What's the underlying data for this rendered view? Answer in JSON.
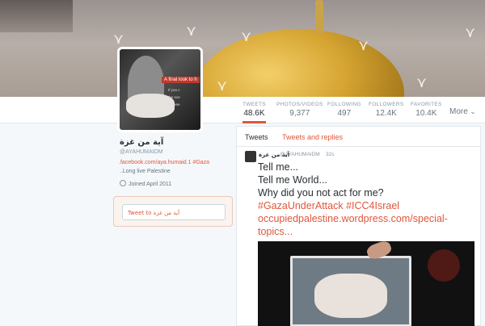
{
  "banner": {
    "birds": [
      "bird",
      "bird",
      "bird",
      "bird",
      "bird",
      "bird",
      "bird",
      "bird"
    ]
  },
  "nav": {
    "stats": [
      {
        "label": "TWEETS",
        "value": "48.6K",
        "active": true
      },
      {
        "label": "PHOTOS/VIDEOS",
        "value": "9,377",
        "active": false
      },
      {
        "label": "FOLLOWING",
        "value": "497",
        "active": false
      },
      {
        "label": "FOLLOWERS",
        "value": "12.4K",
        "active": false
      },
      {
        "label": "FAVORITES",
        "value": "10.4K",
        "active": false
      }
    ],
    "more_label": "More"
  },
  "avatar": {
    "caption": "A final look to h",
    "small_lines": [
      "If you c",
      "the exe",
      "betwee"
    ]
  },
  "profile": {
    "name": "آية من غزة",
    "handle": "@AYAHUMAIDM",
    "bio_link": ".facebook.com/aya.humaid.1",
    "bio_hashtag": "#Gaza",
    "bio_line2": "..Long live Palestine",
    "joined": "Joined April 2011"
  },
  "tweet_to": {
    "label": "Tweet to",
    "name": "آية من غزة"
  },
  "timeline": {
    "tabs": [
      "Tweets",
      "Tweets and replies"
    ],
    "tweet": {
      "name": "آية من غزة",
      "handle": "@AYAHUMAIDM",
      "time": "32s",
      "line1": "Tell me...",
      "line2": "Tell me World...",
      "line3": "Why did you not act for me?",
      "hashtags": "#GazaUnderAttack #ICC4Israel",
      "link1": "occupiedpalestine.wordpress.com/special-",
      "link2": "topics..."
    }
  },
  "colors": {
    "accent": "#e0563b",
    "background": "#f5f8fa"
  }
}
